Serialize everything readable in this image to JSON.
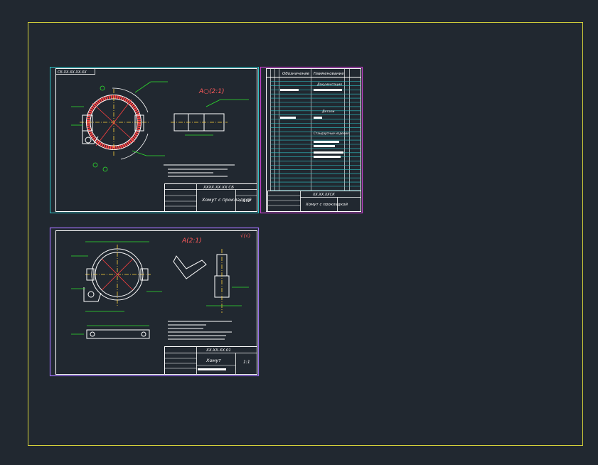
{
  "colors": {
    "background": "#212830",
    "layout_frame": "#d6d23a",
    "sheet_border": "#2ec4c8",
    "spec_border": "#c040c8",
    "sheet3_border": "#9b6ff0",
    "geometry": "#ffffff",
    "dimension": "#2ee02e",
    "centerline": "#ffd23a",
    "hatch": "#ff4040",
    "annotation_red": "#ff5a5a",
    "spec_lines": "#2ec4c8"
  },
  "sheet1": {
    "corner_code": "СБ ХХ.ХХ.ХХ.ХХ",
    "view_label": "А○(2:1)",
    "doc_code": "ХХХХ.ХХ.ХХ СБ",
    "title": "Хомут с прокладкой",
    "sheet_num": "1:1"
  },
  "spec": {
    "headers": [
      "Обозначение",
      "Наименование"
    ],
    "sections": [
      "Документация",
      "Детали",
      "Стандартные изделия"
    ],
    "doc_code": "ХХ.ХХ.ХХСК",
    "title": "Хомут с прокладкой"
  },
  "sheet2": {
    "view_label": "А(2:1)",
    "roughness": "√(√)",
    "doc_code": "ХХ.ХХ.ХХ.01",
    "title": "Хомут",
    "sheet_num": "1:1"
  }
}
